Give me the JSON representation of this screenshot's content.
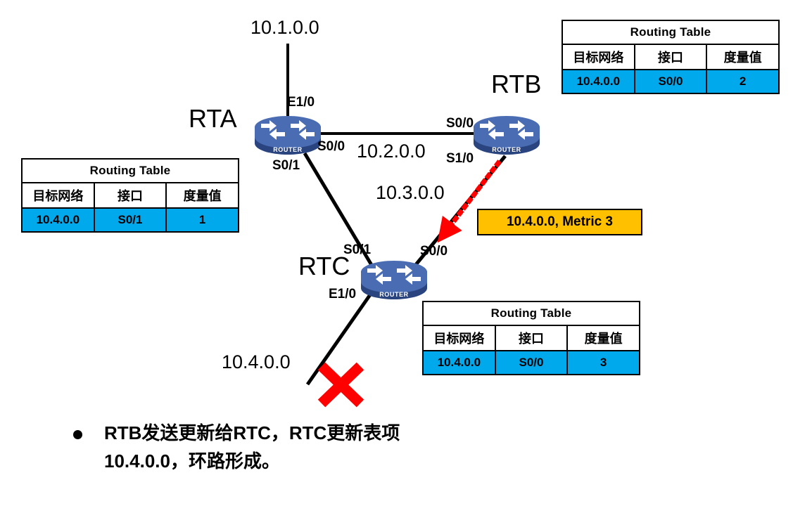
{
  "slide": {
    "title_absent": true,
    "background": "#ffffff"
  },
  "colors": {
    "router_body": "#4a6cb3",
    "router_base": "#2a4480",
    "table_highlight": "#00A8EC",
    "callout_bg": "#FFC000",
    "broken_link": "#FF0000",
    "update_arrow": "#FF0000"
  },
  "networks": {
    "n1": "10.1.0.0",
    "n2": "10.2.0.0",
    "n3": "10.3.0.0",
    "n4": "10.4.0.0"
  },
  "routers": {
    "rta": {
      "name": "RTA",
      "icon_text": "ROUTER",
      "interfaces": {
        "e1_0": "E1/0",
        "s0_0": "S0/0",
        "s0_1": "S0/1"
      }
    },
    "rtb": {
      "name": "RTB",
      "icon_text": "ROUTER",
      "interfaces": {
        "s0_0": "S0/0",
        "s1_0": "S1/0"
      }
    },
    "rtc": {
      "name": "RTC",
      "icon_text": "ROUTER",
      "interfaces": {
        "s0_1": "S0/1",
        "s0_0": "S0/0",
        "e1_0": "E1/0"
      }
    }
  },
  "tables": {
    "headers": {
      "title": "Routing Table",
      "col_network": "目标网络",
      "col_interface": "接口",
      "col_metric": "度量值"
    },
    "rta": {
      "network": "10.4.0.0",
      "interface": "S0/1",
      "metric": "1"
    },
    "rtb": {
      "network": "10.4.0.0",
      "interface": "S0/0",
      "metric": "2"
    },
    "rtc": {
      "network": "10.4.0.0",
      "interface": "S0/0",
      "metric": "3"
    }
  },
  "callout": {
    "text": "10.4.0.0, Metric 3"
  },
  "bullet": {
    "line1": "RTB发送更新给RTC，RTC更新表项",
    "line2": "10.4.0.0，环路形成。"
  }
}
